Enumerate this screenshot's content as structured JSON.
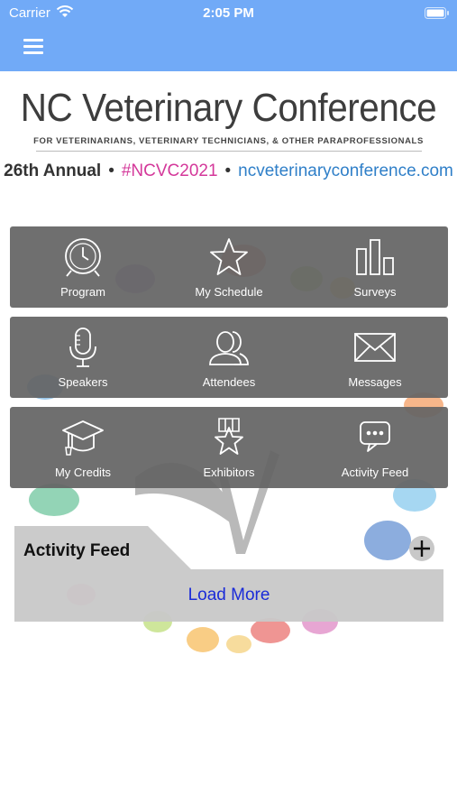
{
  "status_bar": {
    "carrier": "Carrier",
    "time": "2:05 PM"
  },
  "header": {
    "menu_icon": "hamburger-menu-icon"
  },
  "banner": {
    "title": "NC Veterinary Conference",
    "subtitle": "FOR VETERINARIANS, VETERINARY TECHNICIANS, & OTHER PARAPROFESSIONALS",
    "annual": "26th Annual",
    "separator": "•",
    "hashtag": "#NCVC2021",
    "url": "ncveterinaryconference.com",
    "hashtag_color": "#d4389a",
    "url_color": "#2f7fc8"
  },
  "tiles": [
    [
      {
        "label": "Program",
        "icon": "clock-icon"
      },
      {
        "label": "My Schedule",
        "icon": "star-icon"
      },
      {
        "label": "Surveys",
        "icon": "bar-chart-icon"
      }
    ],
    [
      {
        "label": "Speakers",
        "icon": "microphone-icon"
      },
      {
        "label": "Attendees",
        "icon": "people-icon"
      },
      {
        "label": "Messages",
        "icon": "envelope-icon"
      }
    ],
    [
      {
        "label": "My Credits",
        "icon": "graduation-cap-icon"
      },
      {
        "label": "Exhibitors",
        "icon": "award-star-icon"
      },
      {
        "label": "Activity Feed",
        "icon": "chat-bubble-icon"
      }
    ]
  ],
  "activity_feed": {
    "title": "Activity Feed",
    "load_more": "Load More",
    "add_icon": "plus-icon"
  },
  "colors": {
    "header_bg": "#71aaf7",
    "tile_bg": "#646464",
    "load_more": "#1a2bd8"
  }
}
